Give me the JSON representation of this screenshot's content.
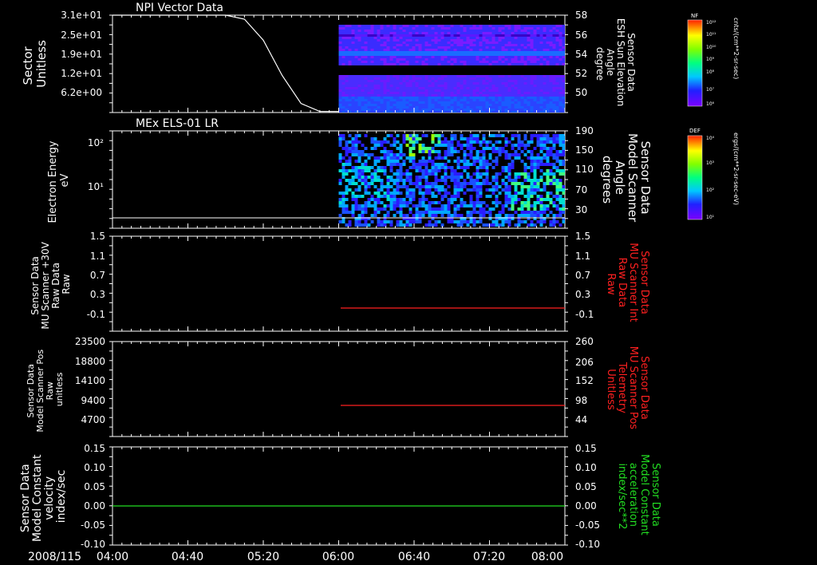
{
  "panels": [
    {
      "title": "NPI Vector Data",
      "left_label": [
        "Sector",
        "Unitless"
      ],
      "left_ticks": [
        "3.1e+01",
        "2.5e+01",
        "1.9e+01",
        "1.2e+01",
        "6.2e+00"
      ],
      "right_label": [
        "Sensor Data",
        "ESH Sun Elevation",
        "Angle",
        "degree"
      ],
      "right_ticks": [
        "58",
        "56",
        "54",
        "52",
        "50"
      ],
      "right_label_color": "#ffffff"
    },
    {
      "title": "MEx ELS-01 LR",
      "left_label": [
        "Electron Energy",
        "eV"
      ],
      "left_ticks": [
        "10²",
        "10¹"
      ],
      "right_label": [
        "Sensor Data",
        "Model Scanner",
        "Angle",
        "degrees"
      ],
      "right_ticks": [
        "190",
        "150",
        "110",
        "70",
        "30"
      ],
      "right_label_color": "#ffffff"
    },
    {
      "title": "",
      "left_label": [
        "Sensor Data",
        "MU Scanner +30V",
        "Raw Data",
        "Raw"
      ],
      "left_ticks": [
        "1.5",
        "1.1",
        "0.7",
        "0.3",
        "-0.1"
      ],
      "right_label": [
        "Sensor Data",
        "MU Scanner Int",
        "Raw Data",
        "Raw"
      ],
      "right_ticks": [
        "1.5",
        "1.1",
        "0.7",
        "0.3",
        "-0.1"
      ],
      "right_label_color": "#ff2020"
    },
    {
      "title": "",
      "left_label": [
        "Sensor Data",
        "Model Scanner Pos",
        "Raw",
        "unitless"
      ],
      "left_ticks": [
        "23500",
        "18800",
        "14100",
        "9400",
        "4700"
      ],
      "right_label": [
        "Sensor Data",
        "MU Scanner Pos",
        "Telemetry",
        "Unitless"
      ],
      "right_ticks": [
        "260",
        "206",
        "152",
        "98",
        "44"
      ],
      "right_label_color": "#ff2020"
    },
    {
      "title": "",
      "left_label": [
        "Sensor Data",
        "Model Constant",
        "velocity",
        "index/sec"
      ],
      "left_ticks": [
        "0.15",
        "0.10",
        "0.05",
        "0.00",
        "-0.05",
        "-0.10"
      ],
      "right_label": [
        "Sensor Data",
        "Model Constant",
        "acceleration",
        "index/sec**2"
      ],
      "right_ticks": [
        "0.15",
        "0.10",
        "0.05",
        "0.00",
        "-0.05",
        "-0.10"
      ],
      "right_label_color": "#22dd22"
    }
  ],
  "colorbars": [
    {
      "name": "NF",
      "ticks": [
        "10¹²",
        "10¹¹",
        "10¹⁰",
        "10⁹",
        "10⁸",
        "10⁷",
        "10⁶"
      ],
      "units": "cnts/(cm**2-sr-sec)"
    },
    {
      "name": "DEF",
      "ticks": [
        "10⁴",
        "10³",
        "10²",
        "10¹"
      ],
      "units": "ergs/(cm**2-sr-sec-eV)"
    }
  ],
  "x_axis": {
    "date_label": "2008/115",
    "ticks": [
      "04:00",
      "04:40",
      "05:20",
      "06:00",
      "06:40",
      "07:20",
      "08:00"
    ]
  },
  "colors": {
    "line_white": "#ffffff",
    "line_red": "#ff2020",
    "line_green": "#22dd22"
  },
  "chart_data": [
    {
      "type": "line",
      "title": "NPI Vector Data",
      "x": [
        "04:00",
        "05:00",
        "05:10",
        "05:20",
        "05:30",
        "05:40",
        "05:50",
        "06:00"
      ],
      "series": [
        {
          "values": [
            58,
            58,
            57.6,
            55.5,
            52.0,
            49.2,
            48.4,
            48.4
          ]
        }
      ],
      "heatmap_region": {
        "x_start": "06:00",
        "x_end": "08:00"
      },
      "ylabel": "Sector Unitless",
      "ylabel_right": "Sensor Data ESH Sun Elevation Angle degree",
      "ylim_right": [
        48.3,
        58
      ]
    },
    {
      "type": "heatmap",
      "title": "MEx ELS-01 LR",
      "x_range": [
        "06:00",
        "08:00"
      ],
      "ylabel": "Electron Energy eV",
      "ylabel_right": "Sensor Data Model Scanner Angle degrees",
      "ylim_right": [
        0,
        190
      ],
      "series": [
        {
          "x": [
            "04:00",
            "08:00"
          ],
          "values": [
            20,
            20
          ]
        }
      ]
    },
    {
      "type": "line",
      "xlabel": "",
      "ylabel": "Sensor Data MU Scanner +30V Raw Data Raw",
      "ylim": [
        -0.3,
        1.5
      ],
      "series": [
        {
          "x": [
            "06:00",
            "08:00"
          ],
          "values": [
            -0.03,
            -0.03
          ]
        }
      ]
    },
    {
      "type": "line",
      "ylabel": "Sensor Data Model Scanner Pos Raw unitless",
      "ylim_right": [
        0,
        260
      ],
      "series": [
        {
          "x": [
            "06:00",
            "08:00"
          ],
          "values": [
            85,
            85
          ]
        }
      ]
    },
    {
      "type": "line",
      "ylabel": "Sensor Data Model Constant velocity index/sec",
      "ylim": [
        -0.1,
        0.15
      ],
      "series": [
        {
          "x": [
            "04:00",
            "08:00"
          ],
          "values": [
            0.0,
            0.0
          ]
        }
      ]
    }
  ]
}
